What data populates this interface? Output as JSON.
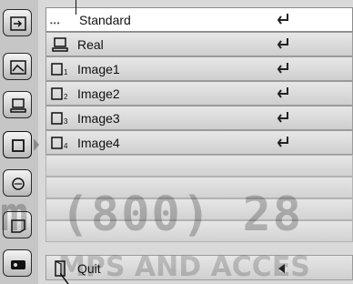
{
  "menu": {
    "items": [
      {
        "label": "Standard",
        "icon": "dots-icon"
      },
      {
        "label": "Real",
        "icon": "monitor-icon"
      },
      {
        "label": "Image1",
        "icon": "image-slot-icon",
        "sub": "1"
      },
      {
        "label": "Image2",
        "icon": "image-slot-icon",
        "sub": "2"
      },
      {
        "label": "Image3",
        "icon": "image-slot-icon",
        "sub": "3"
      },
      {
        "label": "Image4",
        "icon": "image-slot-icon",
        "sub": "4"
      }
    ],
    "quit_label": "Quit"
  },
  "watermark": {
    "line1": "m (800) 28",
    "line2": "MPS AND ACCES"
  },
  "colors": {
    "panel": "#d9d9d9",
    "selected_row": "#ffffff",
    "sidebar": "#c6c6c6"
  }
}
